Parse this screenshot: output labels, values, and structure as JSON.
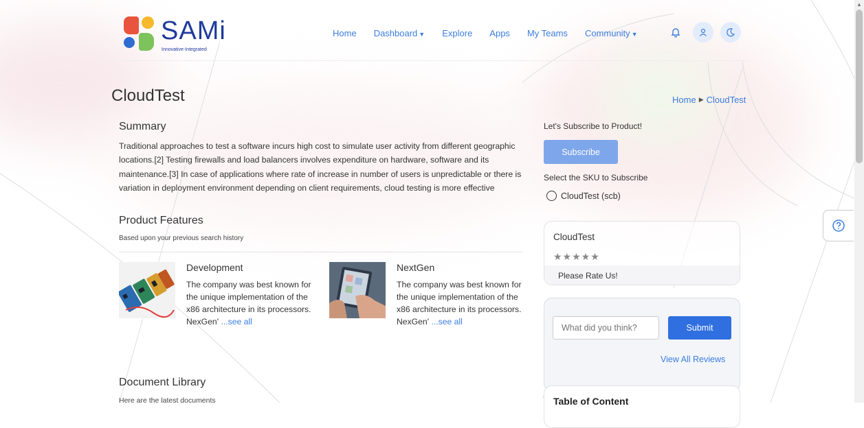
{
  "header": {
    "logo_text": "SAMi",
    "logo_tagline": "Innovative-Integrated",
    "nav": [
      {
        "label": "Home",
        "dropdown": false
      },
      {
        "label": "Dashboard",
        "dropdown": true
      },
      {
        "label": "Explore",
        "dropdown": false
      },
      {
        "label": "Apps",
        "dropdown": false
      },
      {
        "label": "My Teams",
        "dropdown": false
      },
      {
        "label": "Community",
        "dropdown": true
      }
    ],
    "icons": [
      "bell-icon",
      "user-icon",
      "moon-icon"
    ]
  },
  "page": {
    "title": "CloudTest",
    "breadcrumb": [
      "Home",
      "CloudTest"
    ]
  },
  "summary": {
    "heading": "Summary",
    "text": "Traditional approaches to test a software incurs high cost to simulate user activity from different geographic locations.[2] Testing firewalls and load balancers involves expenditure on hardware, software and its maintenance.[3] In case of applications where rate of increase in number of users is unpredictable or there is variation in deployment environment depending on client requirements, cloud testing is more effective"
  },
  "features": {
    "heading": "Product Features",
    "subtitle": "Based upon your previous search history",
    "items": [
      {
        "title": "Development",
        "description": "The company was best known for the unique implementation of the x86 architecture in its processors. NexGen'",
        "more": "...see all",
        "image": "circuit-boards-image"
      },
      {
        "title": "NextGen",
        "description": "The company was best known for the unique implementation of the x86 architecture in its processors. NexGen'",
        "more": "...see all",
        "image": "tablet-hands-image"
      }
    ]
  },
  "document_library": {
    "heading": "Document Library",
    "subtitle": "Here are the latest documents"
  },
  "sidebar": {
    "subscribe_label": "Let's Subscribe to Product!",
    "subscribe_button": "Subscribe",
    "sku_label": "Select the SKU to Subscribe",
    "sku_option": "CloudTest (scb)",
    "rating_card": {
      "title": "CloudTest",
      "stars": "★★★★★",
      "rating": 0,
      "prompt": "Please Rate Us!"
    },
    "review": {
      "placeholder": "What did you think?",
      "submit": "Submit",
      "view_all": "View All Reviews"
    },
    "toc_title": "Table of Content"
  },
  "colors": {
    "link": "#3b7ddd",
    "primary_button": "#2f6fe0",
    "subscribe_button": "#7ea6ea",
    "brand": "#1e3a9c"
  }
}
